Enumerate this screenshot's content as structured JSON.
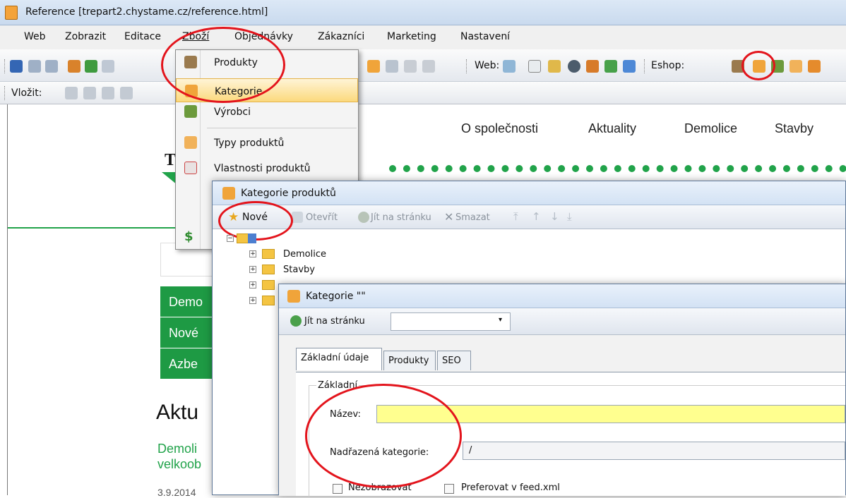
{
  "title": "Reference [trepart2.chystame.cz/reference.html]",
  "menu": [
    "Web",
    "Zobrazit",
    "Editace",
    "Zboží",
    "Objednávky",
    "Zákazníci",
    "Marketing",
    "Nastavení"
  ],
  "toolbar": {
    "web_label": "Web:",
    "eshop_label": "Eshop:",
    "vlozit_label": "Vložit:"
  },
  "dropdown": {
    "items": [
      "Produkty",
      "Kategorie",
      "Výrobci",
      "Typy produktů",
      "Vlastnosti produktů"
    ]
  },
  "website": {
    "nav": [
      "O společnosti",
      "Aktuality",
      "Demolice",
      "Stavby"
    ],
    "logo_letter": "T",
    "green_menu": [
      "Demo",
      "Nové",
      "Azbe"
    ],
    "heading": "Aktu",
    "article_line1": "Demoli",
    "article_line2": "velkoob",
    "date": "3.9.2014"
  },
  "dlg1": {
    "title": "Kategorie produktů",
    "toolbar": {
      "new": "Nové",
      "open": "Otevřít",
      "goto": "Jít na stránku",
      "delete": "Smazat"
    },
    "tree": [
      "Demolice",
      "Stavby"
    ]
  },
  "dlg2": {
    "title": "Kategorie \"\"",
    "goto": "Jít na stránku",
    "tabs": [
      "Základní údaje",
      "Produkty",
      "SEO"
    ],
    "group": "Základní",
    "nazev_label": "Název:",
    "nazev_value": "",
    "parent_label": "Nadřazená kategorie:",
    "parent_value": "/",
    "cb1": "Nezobrazovat",
    "cb2": "Preferovat v feed.xml"
  },
  "colors": {
    "accent_green": "#21a34a",
    "highlight_red": "#e3141c",
    "field_yellow": "#ffff8f"
  }
}
